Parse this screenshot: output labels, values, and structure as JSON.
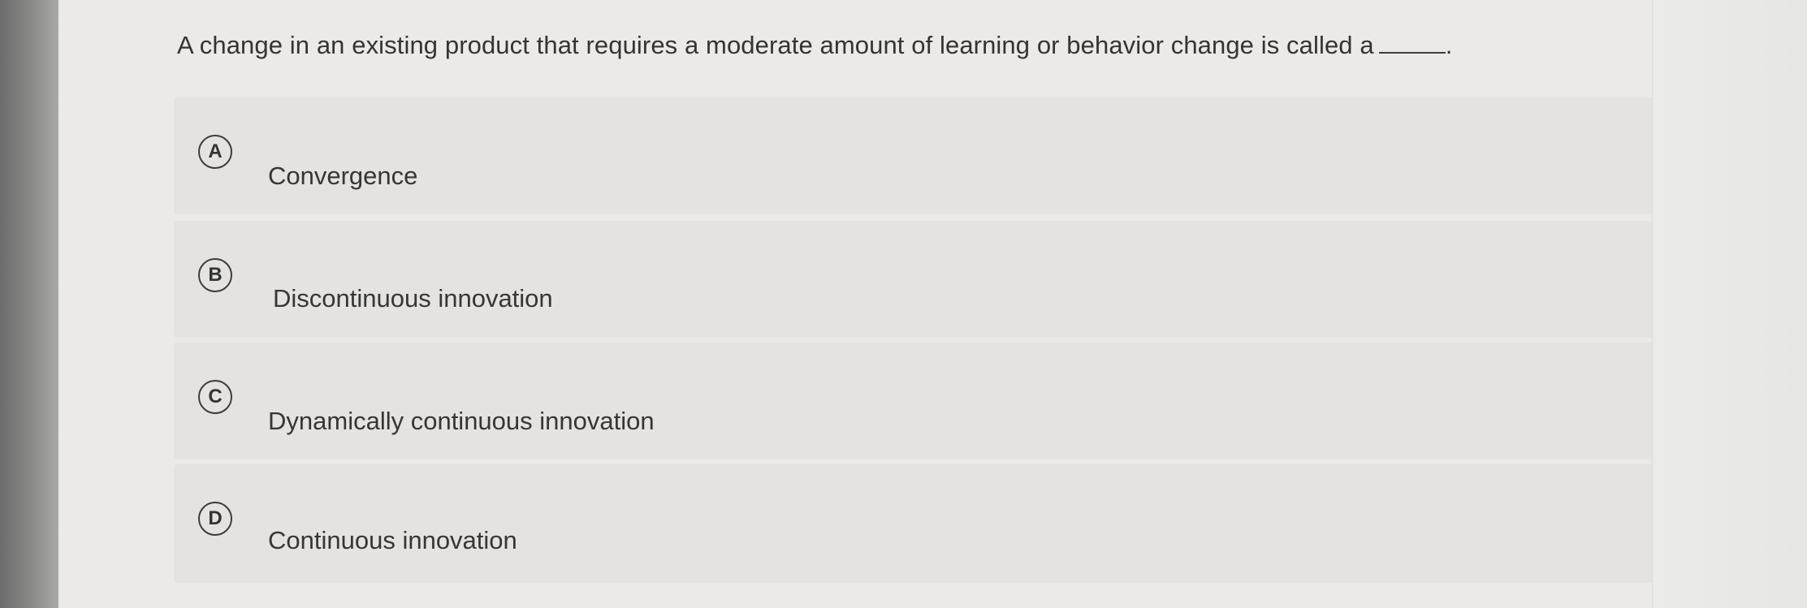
{
  "question": {
    "text": "A change in an existing product that requires a moderate amount of learning or behavior change is called a",
    "end": "."
  },
  "choices": [
    {
      "letter": "A",
      "label": "Convergence"
    },
    {
      "letter": "B",
      "label": "Discontinuous innovation"
    },
    {
      "letter": "C",
      "label": "Dynamically continuous innovation"
    },
    {
      "letter": "D",
      "label": "Continuous innovation"
    }
  ]
}
